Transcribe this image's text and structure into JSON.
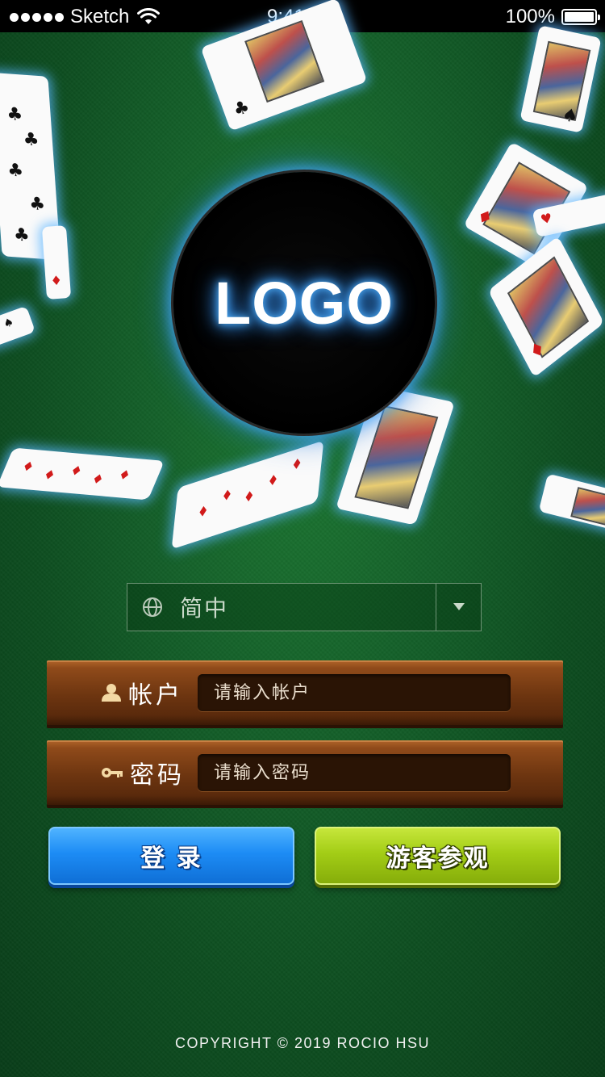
{
  "status_bar": {
    "carrier": "Sketch",
    "time": "9:41 AM",
    "battery": "100%"
  },
  "logo": {
    "text": "LOGO"
  },
  "language_select": {
    "value": "简中",
    "icon": "globe-icon"
  },
  "account_row": {
    "label": "帐户",
    "placeholder": "请输入帐户",
    "icon": "user-icon"
  },
  "password_row": {
    "label": "密码",
    "placeholder": "请输入密码",
    "icon": "key-icon"
  },
  "buttons": {
    "login_label": "登 录",
    "guest_label": "游客参观"
  },
  "footer": {
    "copyright": "COPYRIGHT © 2019 ROCIO HSU"
  },
  "colors": {
    "felt": "#14612a",
    "login_button": "#1d8cf5",
    "guest_button": "#a3cd16",
    "wood": "#6d3510",
    "card_glow": "#5ab4ff"
  }
}
